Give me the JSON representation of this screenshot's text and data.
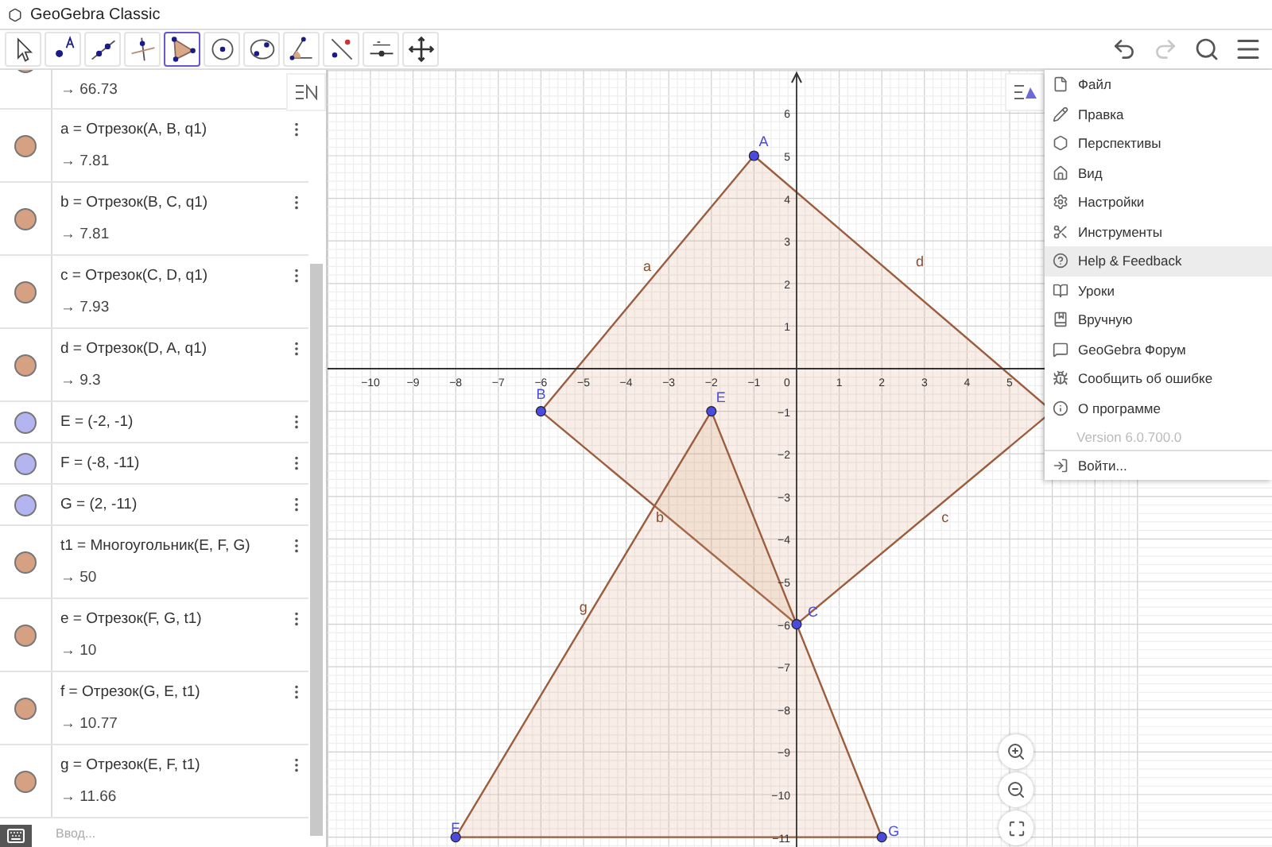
{
  "window": {
    "title": "GeoGebra Classic"
  },
  "toolbar": {
    "tools": [
      {
        "kind": "move",
        "selected": false
      },
      {
        "kind": "point",
        "selected": false
      },
      {
        "kind": "line",
        "selected": false
      },
      {
        "kind": "perpendicular",
        "selected": false
      },
      {
        "kind": "polygon",
        "selected": true
      },
      {
        "kind": "circle",
        "selected": false
      },
      {
        "kind": "conic",
        "selected": false
      },
      {
        "kind": "angle",
        "selected": false
      },
      {
        "kind": "reflect",
        "selected": false
      },
      {
        "kind": "slider",
        "selected": false
      },
      {
        "kind": "move_view",
        "selected": false
      }
    ],
    "undo": {
      "disabled": false
    },
    "redo": {
      "disabled": true
    }
  },
  "algebra": {
    "rows": [
      {
        "kind": "value",
        "value": "→ 66.73",
        "color": "#d6a083"
      },
      {
        "kind": "definition",
        "definition": "a = Отрезок(A, B, q1)",
        "value": "→ 7.81",
        "color": "#d6a083"
      },
      {
        "kind": "definition",
        "definition": "b = Отрезок(B, C, q1)",
        "value": "→ 7.81",
        "color": "#d6a083"
      },
      {
        "kind": "definition",
        "definition": "c = Отрезок(C, D, q1)",
        "value": "→ 7.93",
        "color": "#d6a083"
      },
      {
        "kind": "definition",
        "definition": "d = Отрезок(D, A, q1)",
        "value": "→ 9.3",
        "color": "#d6a083"
      },
      {
        "kind": "point",
        "definition": "E = (-2, -1)",
        "color": "#b4b4f0"
      },
      {
        "kind": "point",
        "definition": "F = (-8, -11)",
        "color": "#b4b4f0"
      },
      {
        "kind": "point",
        "definition": "G = (2, -11)",
        "color": "#b4b4f0"
      },
      {
        "kind": "definition",
        "definition": "t1 = Многоугольник(E, F, G)",
        "value": "→ 50",
        "color": "#d6a083"
      },
      {
        "kind": "definition",
        "definition": "e = Отрезок(F, G, t1)",
        "value": "→ 10",
        "color": "#d6a083"
      },
      {
        "kind": "definition",
        "definition": "f = Отрезок(G, E, t1)",
        "value": "→ 10.77",
        "color": "#d6a083"
      },
      {
        "kind": "definition",
        "definition": "g = Отрезок(E, F, t1)",
        "value": "→ 11.66",
        "color": "#d6a083"
      }
    ],
    "input": {
      "placeholder": "Ввод..."
    }
  },
  "graphics": {
    "x_labels": [
      "−10",
      "−9",
      "−8",
      "−7",
      "−6",
      "−5",
      "−4",
      "−3",
      "−2",
      "−1",
      "0",
      "1",
      "2",
      "3",
      "4",
      "5"
    ],
    "y_labels": [
      "6",
      "5",
      "4",
      "3",
      "2",
      "1",
      "−1",
      "−2",
      "−3",
      "−4",
      "−5",
      "−6",
      "−7",
      "−8",
      "−9",
      "−10",
      "−11"
    ],
    "point_labels": [
      "A",
      "B",
      "C",
      "E",
      "F",
      "G"
    ],
    "segment_labels": [
      "a",
      "b",
      "c",
      "d",
      "g"
    ]
  },
  "menu": {
    "items": [
      {
        "kind": "file",
        "label": "Файл",
        "selected": false
      },
      {
        "kind": "edit",
        "label": "Правка",
        "selected": false
      },
      {
        "kind": "perspectives",
        "label": "Перспективы",
        "selected": false
      },
      {
        "kind": "view",
        "label": "Вид",
        "selected": false
      },
      {
        "kind": "settings",
        "label": "Настройки",
        "selected": false
      },
      {
        "kind": "tools",
        "label": "Инструменты",
        "selected": false
      },
      {
        "kind": "help",
        "label": "Help & Feedback",
        "selected": true
      },
      {
        "kind": "tutorials",
        "label": "Уроки",
        "selected": false
      },
      {
        "kind": "manual",
        "label": "Вручную",
        "selected": false
      },
      {
        "kind": "forum",
        "label": "GeoGebra Форум",
        "selected": false
      },
      {
        "kind": "bug",
        "label": "Сообщить об ошибке",
        "selected": false
      },
      {
        "kind": "about",
        "label": "О программе",
        "selected": false
      },
      {
        "kind": "version",
        "label": "Version 6.0.700.0",
        "selected": false
      },
      {
        "kind": "signin",
        "label": "Войти...",
        "selected": false
      }
    ]
  }
}
